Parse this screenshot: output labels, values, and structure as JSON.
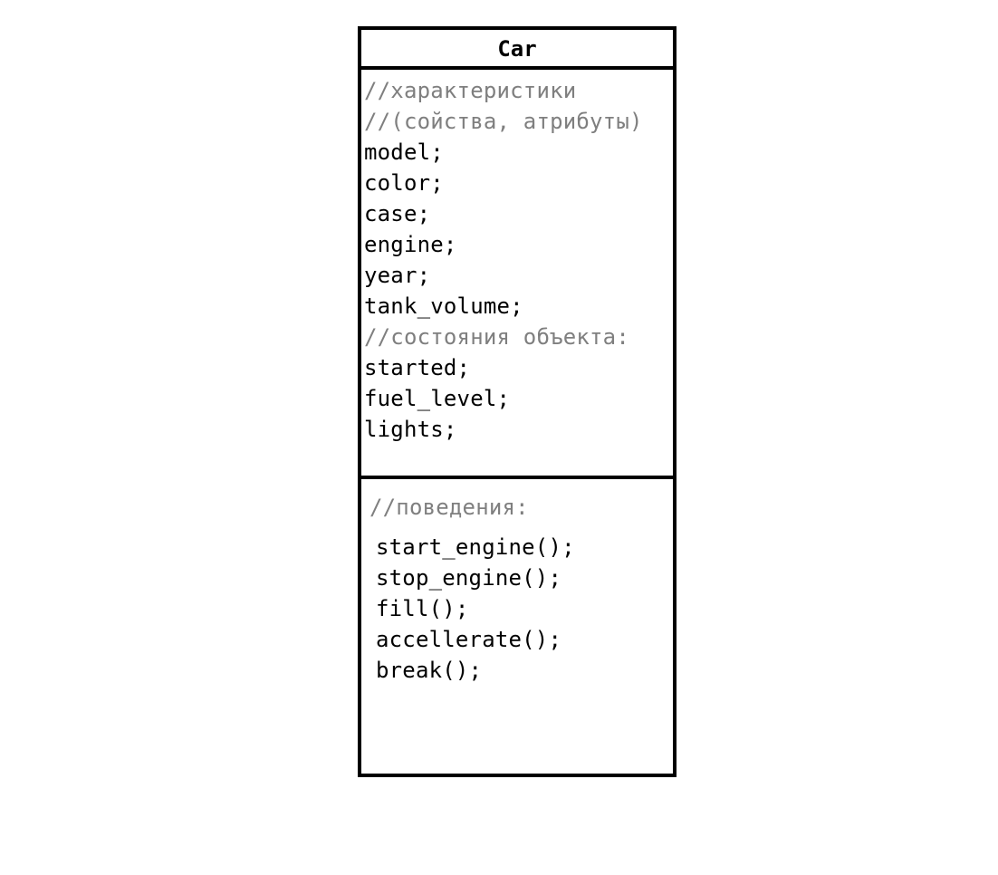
{
  "diagram": {
    "class_name": "Car",
    "attributes": [
      {
        "text": "//характеристики",
        "kind": "comment"
      },
      {
        "text": "//(сойства, атрибуты)",
        "kind": "comment"
      },
      {
        "text": "model;",
        "kind": "code"
      },
      {
        "text": "color;",
        "kind": "code"
      },
      {
        "text": "case;",
        "kind": "code"
      },
      {
        "text": "engine;",
        "kind": "code"
      },
      {
        "text": "year;",
        "kind": "code"
      },
      {
        "text": "tank_volume;",
        "kind": "code"
      },
      {
        "text": "//состояния объекта:",
        "kind": "comment"
      },
      {
        "text": "started;",
        "kind": "code"
      },
      {
        "text": "fuel_level;",
        "kind": "code"
      },
      {
        "text": "lights;",
        "kind": "code"
      }
    ],
    "methods_comment": "//поведения:",
    "methods": [
      "start_engine();",
      "stop_engine();",
      "fill();",
      "accellerate();",
      "break();"
    ],
    "colors": {
      "border": "#000000",
      "code_text": "#000000",
      "comment_text": "#7f7f7f"
    }
  }
}
